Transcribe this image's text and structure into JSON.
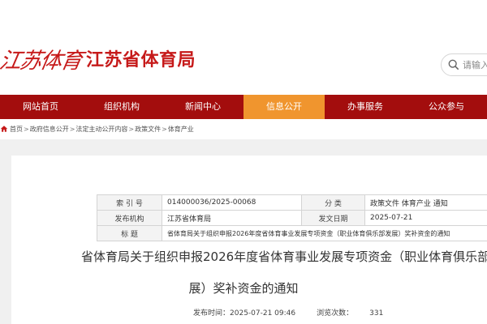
{
  "header": {
    "logo_calligraphy": "江苏体育",
    "logo_name": "江苏省体育局",
    "search_placeholder": "请输入"
  },
  "nav": {
    "items": [
      {
        "label": "网站首页"
      },
      {
        "label": "组织机构"
      },
      {
        "label": "新闻中心"
      },
      {
        "label": "信息公开"
      },
      {
        "label": "办事服务"
      },
      {
        "label": "公众参与"
      }
    ],
    "active_index": 3,
    "bar_color": "#a30d0d",
    "active_color": "#f0952e"
  },
  "breadcrumb": {
    "items": [
      "首页",
      "政府信息公开",
      "法定主动公开内容",
      "政策文件",
      "体育产业"
    ],
    "separator": ">"
  },
  "meta": {
    "index_label": "索 引 号",
    "index_value": "014000036/2025-00068",
    "category_label": "分 类",
    "category_value": "政策文件 体育产业 通知",
    "publisher_label": "发布机构",
    "publisher_value": "江苏省体育局",
    "date_label": "发文日期",
    "date_value": "2025-07-21",
    "title_label": "标 题",
    "title_value": "省体育局关于组织申报2026年度省体育事业发展专项资金（职业体育俱乐部发展）奖补资金的通知"
  },
  "document": {
    "title_line1": "省体育局关于组织申报2026年度省体育事业发展专项资金（职业体育俱乐部",
    "title_line2": "展）奖补资金的通知",
    "publish_time_label": "发布时间：",
    "publish_time": "2025-07-21 09:46",
    "views_label": "浏览次数：",
    "views": "331"
  }
}
